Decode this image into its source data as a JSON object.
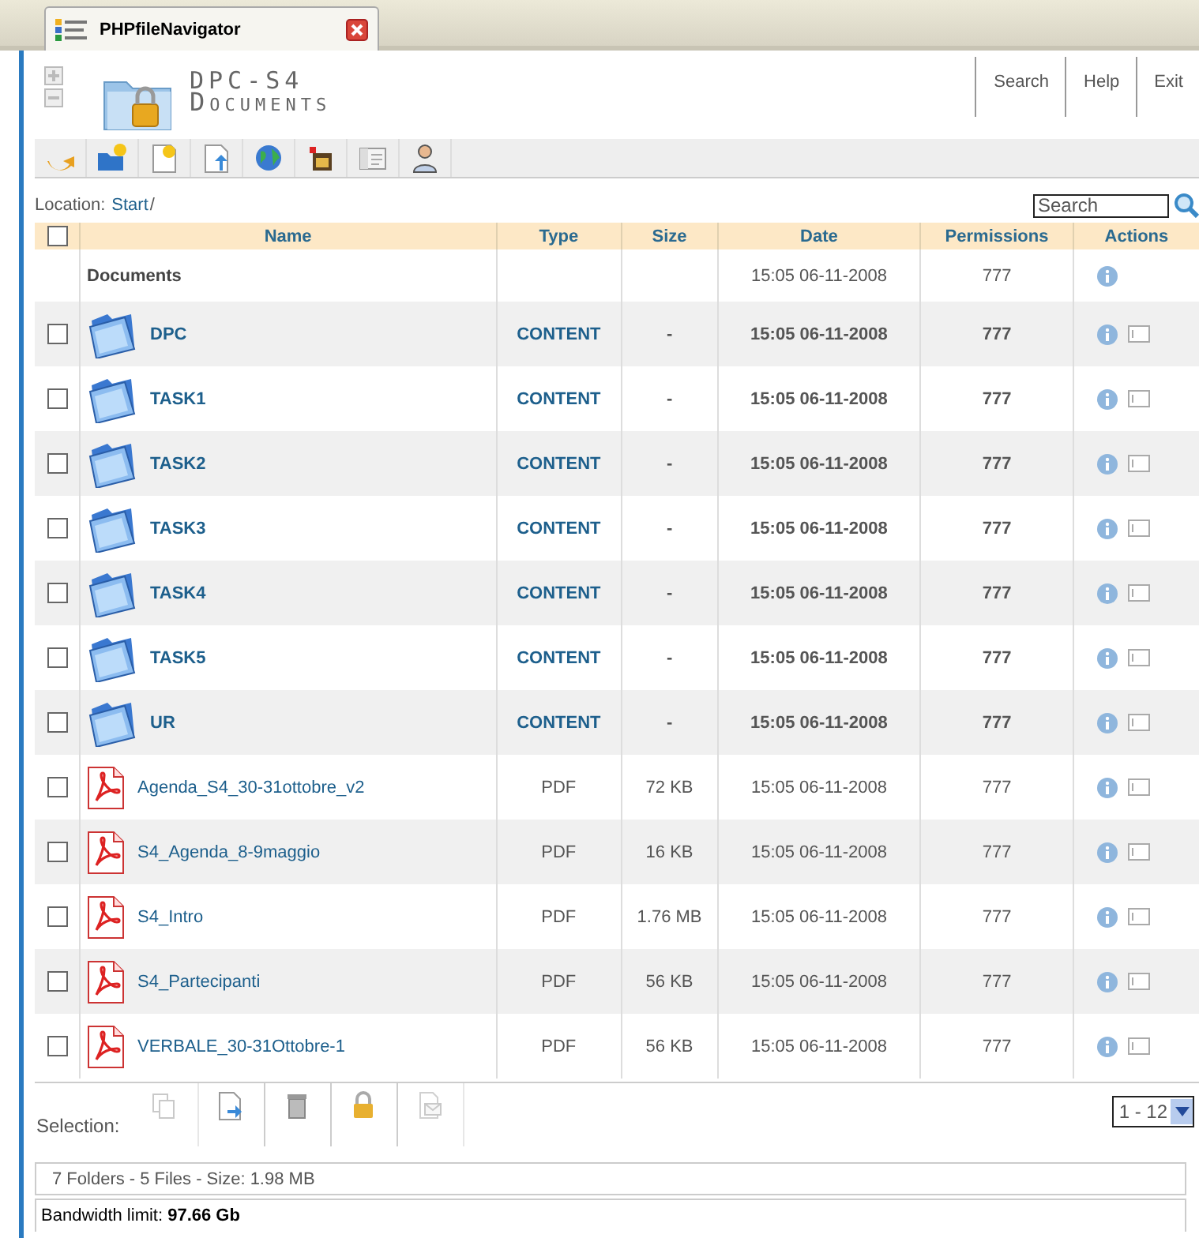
{
  "browser_tab": {
    "title": "PHPfileNavigator"
  },
  "header": {
    "title": "DPC-S4",
    "subtitle": "Documents",
    "nav": [
      "Search",
      "Help",
      "Exit"
    ]
  },
  "location": {
    "label": "Location:",
    "path": "Start",
    "separator": "/"
  },
  "search": {
    "placeholder": "Search"
  },
  "table": {
    "select_all_checked": false,
    "columns": [
      "Name",
      "Type",
      "Size",
      "Date",
      "Permissions",
      "Actions"
    ],
    "parent": {
      "name": "Documents",
      "date": "15:05 06-11-2008",
      "permissions": "777"
    },
    "rows": [
      {
        "kind": "folder",
        "name": "DPC",
        "type": "CONTENT",
        "size": "-",
        "date": "15:05 06-11-2008",
        "permissions": "777",
        "checked": false
      },
      {
        "kind": "folder",
        "name": "TASK1",
        "type": "CONTENT",
        "size": "-",
        "date": "15:05 06-11-2008",
        "permissions": "777",
        "checked": false
      },
      {
        "kind": "folder",
        "name": "TASK2",
        "type": "CONTENT",
        "size": "-",
        "date": "15:05 06-11-2008",
        "permissions": "777",
        "checked": false
      },
      {
        "kind": "folder",
        "name": "TASK3",
        "type": "CONTENT",
        "size": "-",
        "date": "15:05 06-11-2008",
        "permissions": "777",
        "checked": false
      },
      {
        "kind": "folder",
        "name": "TASK4",
        "type": "CONTENT",
        "size": "-",
        "date": "15:05 06-11-2008",
        "permissions": "777",
        "checked": false
      },
      {
        "kind": "folder",
        "name": "TASK5",
        "type": "CONTENT",
        "size": "-",
        "date": "15:05 06-11-2008",
        "permissions": "777",
        "checked": false
      },
      {
        "kind": "folder",
        "name": "UR",
        "type": "CONTENT",
        "size": "-",
        "date": "15:05 06-11-2008",
        "permissions": "777",
        "checked": false
      },
      {
        "kind": "pdf",
        "name": "Agenda_S4_30-31ottobre_v2",
        "type": "PDF",
        "size": "72 KB",
        "date": "15:05 06-11-2008",
        "permissions": "777",
        "checked": false
      },
      {
        "kind": "pdf",
        "name": "S4_Agenda_8-9maggio",
        "type": "PDF",
        "size": "16 KB",
        "date": "15:05 06-11-2008",
        "permissions": "777",
        "checked": false
      },
      {
        "kind": "pdf",
        "name": "S4_Intro",
        "type": "PDF",
        "size": "1.76 MB",
        "date": "15:05 06-11-2008",
        "permissions": "777",
        "checked": false
      },
      {
        "kind": "pdf",
        "name": "S4_Partecipanti",
        "type": "PDF",
        "size": "56 KB",
        "date": "15:05 06-11-2008",
        "permissions": "777",
        "checked": false
      },
      {
        "kind": "pdf",
        "name": "VERBALE_30-31Ottobre-1",
        "type": "PDF",
        "size": "56 KB",
        "date": "15:05 06-11-2008",
        "permissions": "777",
        "checked": false
      }
    ]
  },
  "selection": {
    "label": "Selection:",
    "actions": [
      {
        "disabled": true
      },
      {
        "disabled": false
      },
      {
        "disabled": false
      },
      {
        "disabled": false
      },
      {
        "disabled": true
      }
    ]
  },
  "pager": {
    "value": "1 - 12"
  },
  "summary": "7 Folders - 5 Files - Size: 1.98 MB",
  "bandwidth": "Bandwidth limit: **97.66 Gb**"
}
